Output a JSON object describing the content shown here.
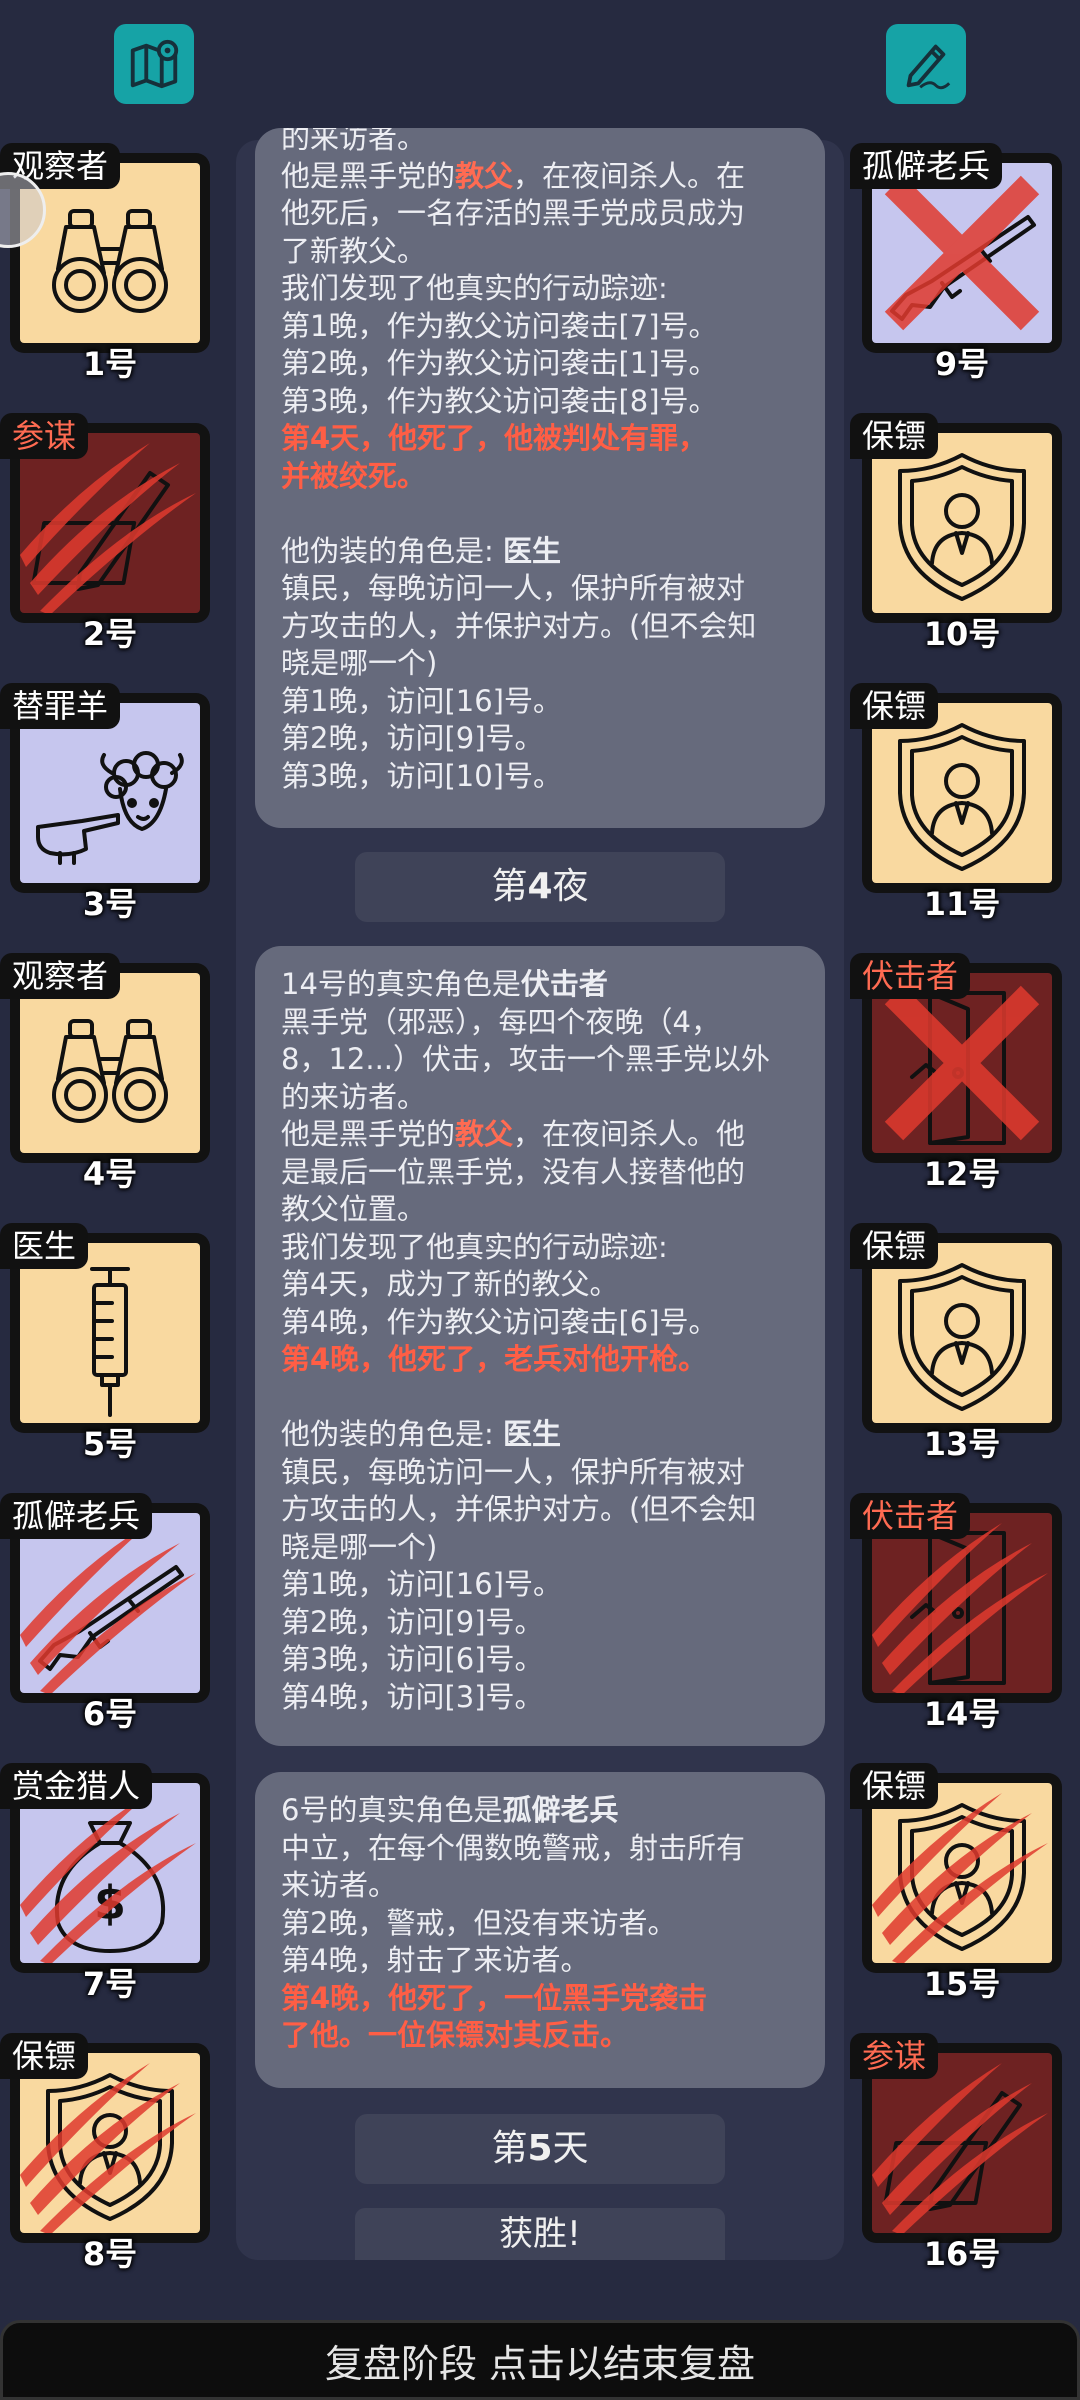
{
  "top_left_icon": "map-icon",
  "top_right_icon": "edit-notes-icon",
  "players_left": [
    {
      "role": "观察者",
      "num": "1号",
      "role_color": "white",
      "bg": "yellow",
      "art": "binoculars",
      "status": "alive"
    },
    {
      "role": "参谋",
      "num": "2号",
      "role_color": "red",
      "bg": "maroon",
      "art": "pen",
      "status": "clawed"
    },
    {
      "role": "替罪羊",
      "num": "3号",
      "role_color": "white",
      "bg": "lavender",
      "art": "scapegoat",
      "status": "alive"
    },
    {
      "role": "观察者",
      "num": "4号",
      "role_color": "white",
      "bg": "yellow",
      "art": "binoculars",
      "status": "alive"
    },
    {
      "role": "医生",
      "num": "5号",
      "role_color": "white",
      "bg": "yellow",
      "art": "syringe",
      "status": "alive"
    },
    {
      "role": "孤僻老兵",
      "num": "6号",
      "role_color": "white",
      "bg": "lavender",
      "art": "rifle",
      "status": "clawed"
    },
    {
      "role": "赏金猎人",
      "num": "7号",
      "role_color": "white",
      "bg": "lavender",
      "art": "moneybag",
      "status": "clawed"
    },
    {
      "role": "保镖",
      "num": "8号",
      "role_color": "white",
      "bg": "yellow",
      "art": "shield",
      "status": "clawed"
    }
  ],
  "players_right": [
    {
      "role": "孤僻老兵",
      "num": "9号",
      "role_color": "white",
      "bg": "lavender",
      "art": "rifle",
      "status": "crossed"
    },
    {
      "role": "保镖",
      "num": "10号",
      "role_color": "white",
      "bg": "yellow",
      "art": "shield",
      "status": "alive"
    },
    {
      "role": "保镖",
      "num": "11号",
      "role_color": "white",
      "bg": "yellow",
      "art": "shield",
      "status": "alive"
    },
    {
      "role": "伏击者",
      "num": "12号",
      "role_color": "red",
      "bg": "maroon",
      "art": "door",
      "status": "crossed"
    },
    {
      "role": "保镖",
      "num": "13号",
      "role_color": "white",
      "bg": "yellow",
      "art": "shield",
      "status": "alive"
    },
    {
      "role": "伏击者",
      "num": "14号",
      "role_color": "red",
      "bg": "maroon",
      "art": "door",
      "status": "clawed"
    },
    {
      "role": "保镖",
      "num": "15号",
      "role_color": "white",
      "bg": "yellow",
      "art": "shield",
      "status": "clawed"
    },
    {
      "role": "参谋",
      "num": "16号",
      "role_color": "red",
      "bg": "maroon",
      "art": "pen",
      "status": "clawed"
    }
  ],
  "log": {
    "b1": {
      "l0": "的来访者。",
      "l1a": "他是黑手党的",
      "l1b": "教父",
      "l1c": "，在夜间杀人。在",
      "l2": "他死后，一名存活的黑手党成员成为",
      "l3": "了新教父。",
      "l4": "我们发现了他真实的行动踪迹:",
      "l5": "第1晚，作为教父访问袭击[7]号。",
      "l6": "第2晚，作为教父访问袭击[1]号。",
      "l7": "第3晚，作为教父访问袭击[8]号。",
      "l8": "第4天，他死了，他被判处有罪，",
      "l9": "并被绞死。",
      "l11a": "他伪装的角色是: ",
      "l11b": "医生",
      "l12": "镇民，每晚访问一人，保护所有被对",
      "l13": "方攻击的人，并保护对方。(但不会知",
      "l14": "晓是哪一个)",
      "l15": "第1晚，访问[16]号。",
      "l16": "第2晚，访问[9]号。",
      "l17": "第3晚，访问[10]号。"
    },
    "night4_a": "第",
    "night4_b": "4",
    "night4_c": "夜",
    "b2": {
      "l0a": "14号的真实角色是",
      "l0b": "伏击者",
      "l1": "黑手党（邪恶），每四个夜晚（4，",
      "l2": "8，12...）伏击，攻击一个黑手党以外",
      "l3": "的来访者。",
      "l4a": "他是黑手党的",
      "l4b": "教父",
      "l4c": "，在夜间杀人。他",
      "l5": "是最后一位黑手党，没有人接替他的",
      "l6": "教父位置。",
      "l7": "我们发现了他真实的行动踪迹:",
      "l8": "第4天，成为了新的教父。",
      "l9": "第4晚，作为教父访问袭击[6]号。",
      "l10": "第4晚，他死了，老兵对他开枪。",
      "l12a": "他伪装的角色是: ",
      "l12b": "医生",
      "l13": "镇民，每晚访问一人，保护所有被对",
      "l14": "方攻击的人，并保护对方。(但不会知",
      "l15": "晓是哪一个)",
      "l16": "第1晚，访问[16]号。",
      "l17": "第2晚，访问[9]号。",
      "l18": "第3晚，访问[6]号。",
      "l19": "第4晚，访问[3]号。"
    },
    "b3": {
      "l0a": "6号的真实角色是",
      "l0b": "孤僻老兵",
      "l1": "中立，在每个偶数晚警戒，射击所有",
      "l2": "来访者。",
      "l3": "第2晚，警戒，但没有来访者。",
      "l4": "第4晚，射击了来访者。",
      "l5": "第4晚，他死了，一位黑手党袭击",
      "l6": "了他。一位保镖对其反击。"
    },
    "day5_a": "第",
    "day5_b": "5",
    "day5_c": "天",
    "victory": "获胜!"
  },
  "bottom_bar": "复盘阶段 点击以结束复盘"
}
